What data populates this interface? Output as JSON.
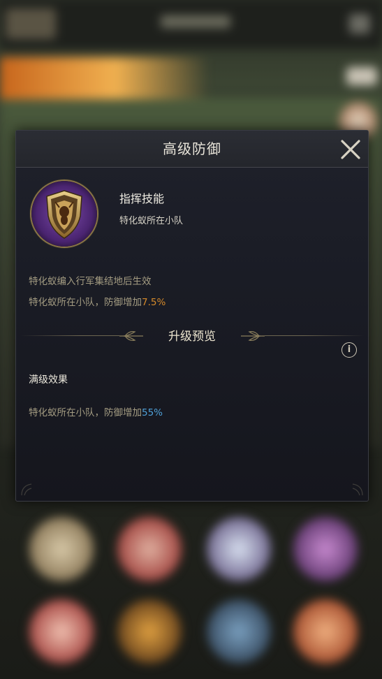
{
  "dialog": {
    "title": "高级防御",
    "skill_type": "指挥技能",
    "skill_target": "特化蚁所在小队",
    "desc_line1": "特化蚁编入行军集结地后生效",
    "desc_line2_prefix": "特化蚁所在小队，防御增加",
    "desc_line2_value": "7.5%",
    "upgrade_section_title": "升级预览",
    "max_level_title": "满级效果",
    "max_level_desc_prefix": "特化蚁所在小队，防御增加",
    "max_level_value": "55%"
  },
  "icons": {
    "close": "close-icon",
    "info": "info-icon",
    "skill": "shield-ant-icon",
    "laurel": "laurel-icon"
  },
  "colors": {
    "accent_orange": "#d68a2a",
    "accent_blue": "#4fa0d8",
    "dialog_bg": "#1a1c25",
    "title_text": "#e9e5da"
  }
}
